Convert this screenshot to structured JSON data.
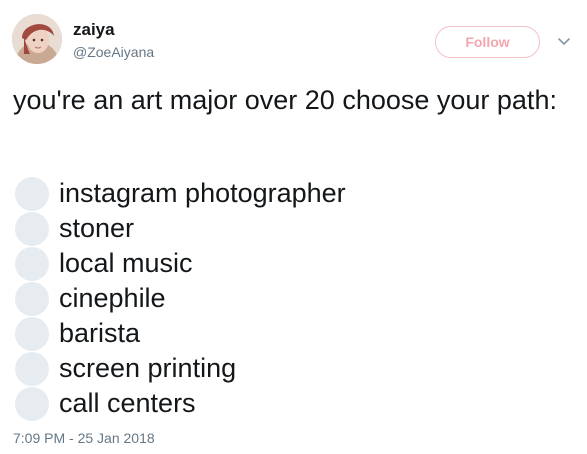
{
  "user": {
    "display_name": "zaiya",
    "handle": "@ZoeAiyana"
  },
  "follow_label": "Follow",
  "tweet": {
    "text": "you're an art major over 20 choose your path:",
    "options": [
      "instagram photographer",
      "stoner",
      "local music",
      "cinephile",
      "barista",
      "screen printing",
      "call centers"
    ],
    "timestamp": "7:09 PM - 25 Jan 2018"
  },
  "colors": {
    "follow_border": "#f4c2c9",
    "follow_text": "#f4a6b0",
    "radio_fill": "#e6ecf0",
    "muted_text": "#657786",
    "text": "#14171a"
  },
  "icons": {
    "avatar": "avatar-photo",
    "menu": "chevron-down-icon",
    "option_marker": "radio-circle-icon"
  }
}
